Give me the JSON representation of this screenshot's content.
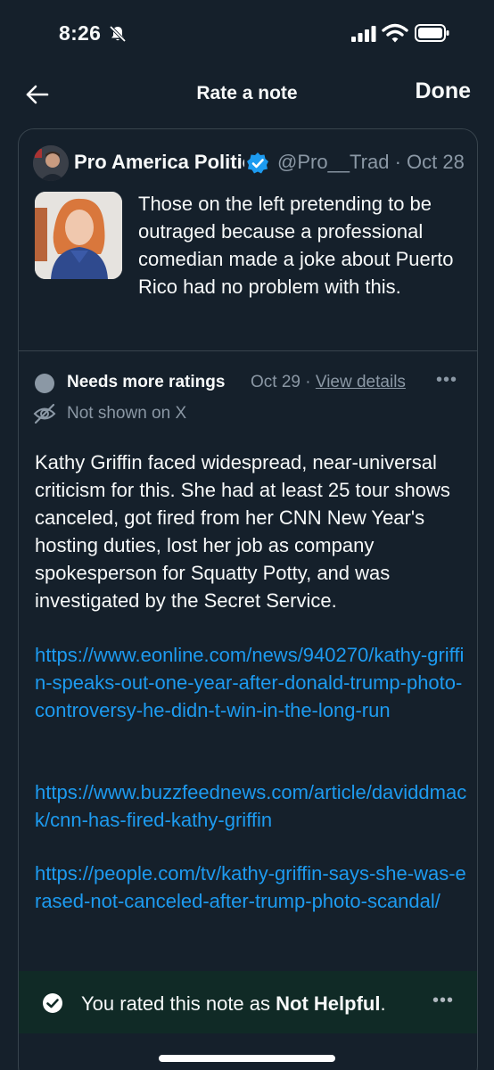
{
  "status_bar": {
    "time": "8:26"
  },
  "nav": {
    "title": "Rate a note",
    "done_label": "Done"
  },
  "tweet": {
    "author_name": "Pro America Politics",
    "handle": "@Pro__Trad",
    "date": "Oct 28",
    "text": "Those on the left pretending to be outraged because a professional comedian made a joke about Puerto Rico had no problem with this."
  },
  "note": {
    "status": "Needs more ratings",
    "date": "Oct 29",
    "view_details": "View details",
    "visibility": "Not shown on X",
    "body": "Kathy Griffin faced widespread, near-universal criticism for this. She had at least 25 tour shows canceled, got fired from her CNN New Year's hosting duties, lost her job as company spokesperson for Squatty Potty, and was investigated by the Secret Service.",
    "links": [
      "https://www.eonline.com/news/940270/kathy-griffin-speaks-out-one-year-after-donald-trump-photo-controversy-he-didn-t-win-in-the-long-run",
      "https://www.buzzfeednews.com/article/daviddmack/cnn-has-fired-kathy-griffin",
      "https://people.com/tv/kathy-griffin-says-she-was-erased-not-canceled-after-trump-photo-scandal/"
    ]
  },
  "rating": {
    "prefix": "You rated this note as ",
    "value": "Not Helpful",
    "suffix": "."
  },
  "colors": {
    "accent_link": "#1d9bf0",
    "background": "#15202b",
    "muted": "#8b98a5",
    "rated_bg": "#102a26"
  }
}
